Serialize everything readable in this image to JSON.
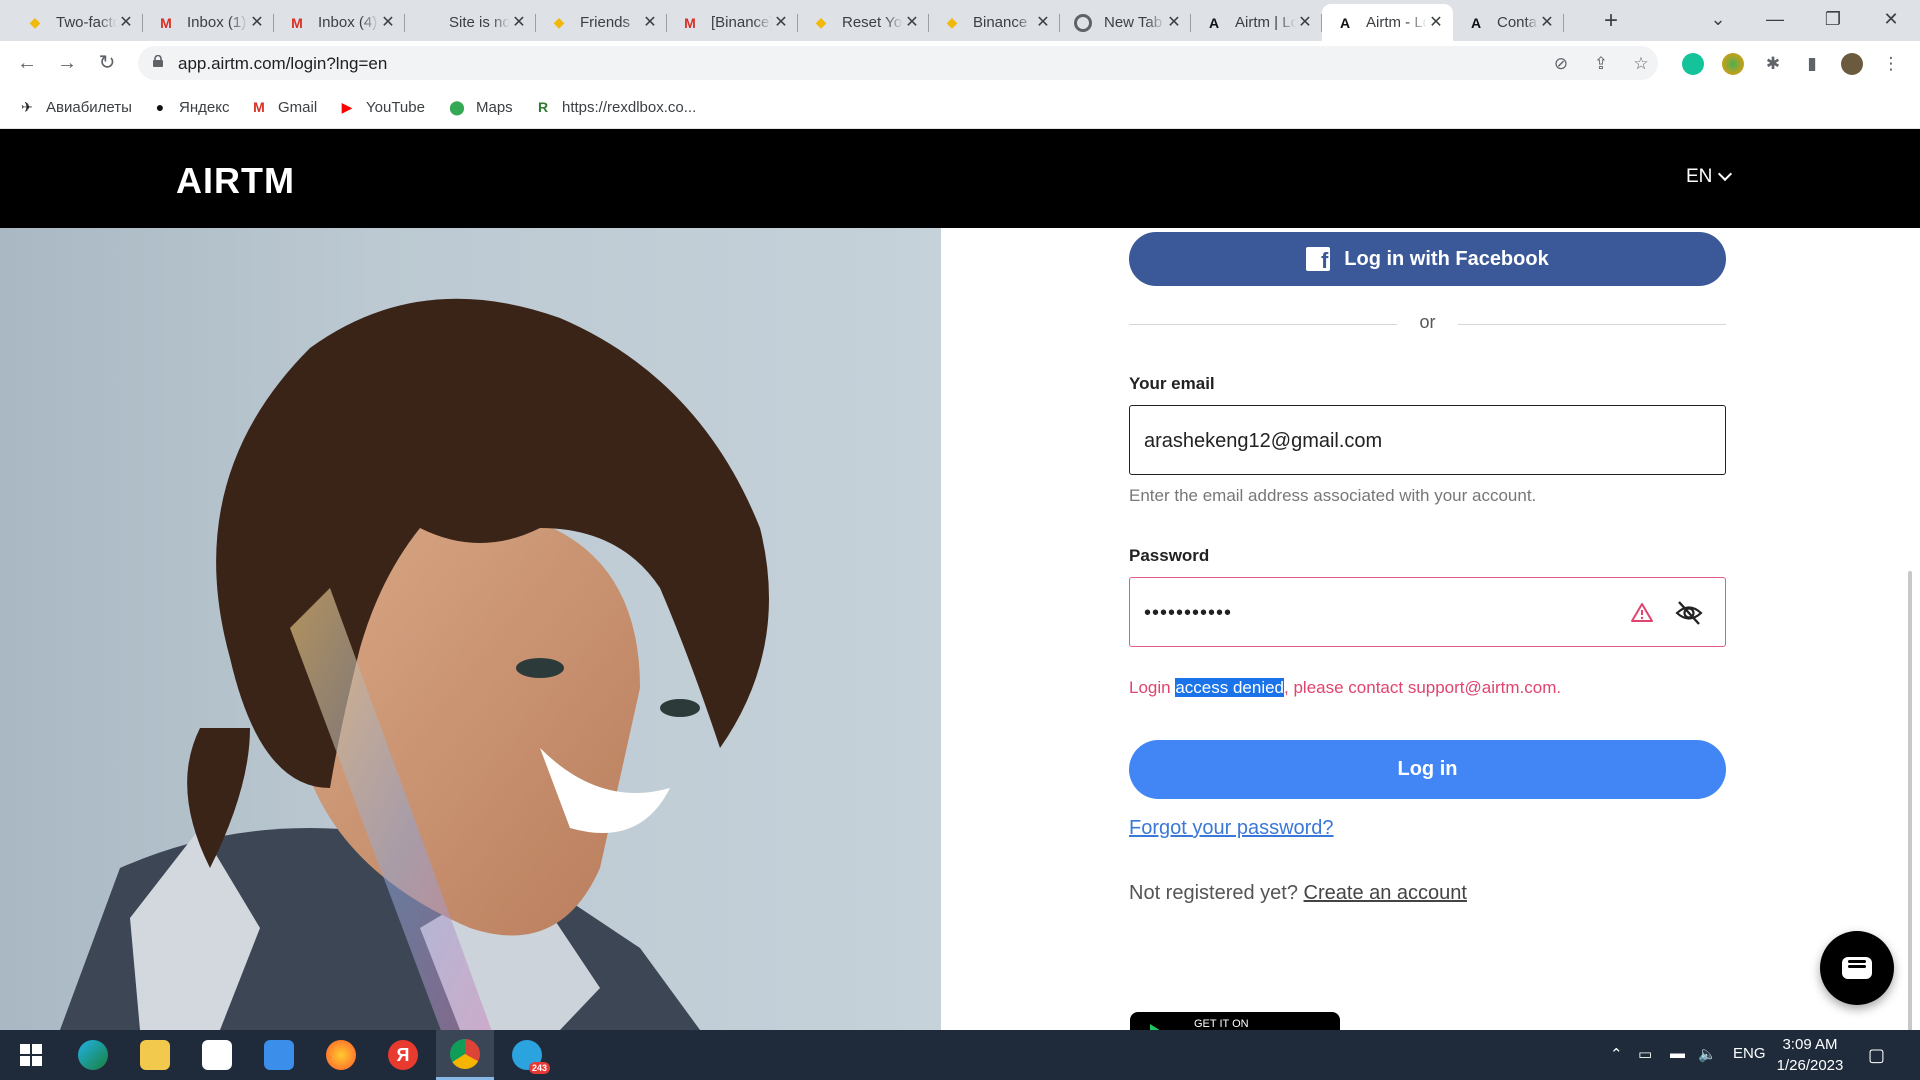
{
  "browser": {
    "tabs": [
      {
        "title": "Two-factor",
        "favicon": "binance-icon",
        "active": false
      },
      {
        "title": "Inbox (1)",
        "favicon": "gmail-icon",
        "active": false
      },
      {
        "title": "Inbox (4)",
        "favicon": "gmail-icon",
        "active": false
      },
      {
        "title": "Site is not secure",
        "favicon": "none",
        "active": false
      },
      {
        "title": "Friends",
        "favicon": "binance-icon",
        "active": false
      },
      {
        "title": "[Binance]",
        "favicon": "gmail-icon",
        "active": false
      },
      {
        "title": "Reset Your",
        "favicon": "binance-icon",
        "active": false
      },
      {
        "title": "Binance",
        "favicon": "binance-icon",
        "active": false
      },
      {
        "title": "New Tab",
        "favicon": "chrome-icon",
        "active": false
      },
      {
        "title": "Airtm | Login",
        "favicon": "airtm-icon",
        "active": false
      },
      {
        "title": "Airtm - Login",
        "favicon": "airtm-icon",
        "active": true
      },
      {
        "title": "Contact",
        "favicon": "airtm-icon",
        "active": false
      }
    ],
    "url": "app.airtm.com/login?lng=en",
    "bookmarks": [
      {
        "label": "Авиабилеты",
        "icon": "plane-icon"
      },
      {
        "label": "Яндекс",
        "icon": "yandex-icon"
      },
      {
        "label": "Gmail",
        "icon": "gmail-icon"
      },
      {
        "label": "YouTube",
        "icon": "youtube-icon"
      },
      {
        "label": "Maps",
        "icon": "maps-icon"
      },
      {
        "label": "https://rexdlbox.co...",
        "icon": "rexdl-icon"
      }
    ]
  },
  "site": {
    "logo": "AIRTM",
    "language": "EN"
  },
  "login": {
    "facebook_label": "Log in with Facebook",
    "or_label": "or",
    "email_label": "Your email",
    "email_value": "arashekeng12@gmail.com",
    "email_hint": "Enter the email address associated with your account.",
    "password_label": "Password",
    "password_value": "•••••••••••",
    "error_prefix": "Login ",
    "error_selected": "access denied",
    "error_suffix": ", please contact support@airtm.com.",
    "login_button": "Log in",
    "forgot_link": "Forgot your password?",
    "register_prompt": "Not registered yet?",
    "register_link": "Create an account",
    "google_play_label": "GET IT ON"
  },
  "colors": {
    "facebook": "#3b5998",
    "primary": "#4285f4",
    "error": "#e0446e",
    "header_bg": "#000000"
  },
  "taskbar": {
    "apps": [
      "windows-start-icon",
      "edge-icon",
      "file-explorer-icon",
      "store-icon",
      "mail-icon",
      "firefox-icon",
      "yandex-browser-icon",
      "chrome-icon",
      "telegram-icon"
    ],
    "telegram_badge": "243",
    "language": "ENG",
    "time": "3:09 AM",
    "date": "1/26/2023"
  }
}
